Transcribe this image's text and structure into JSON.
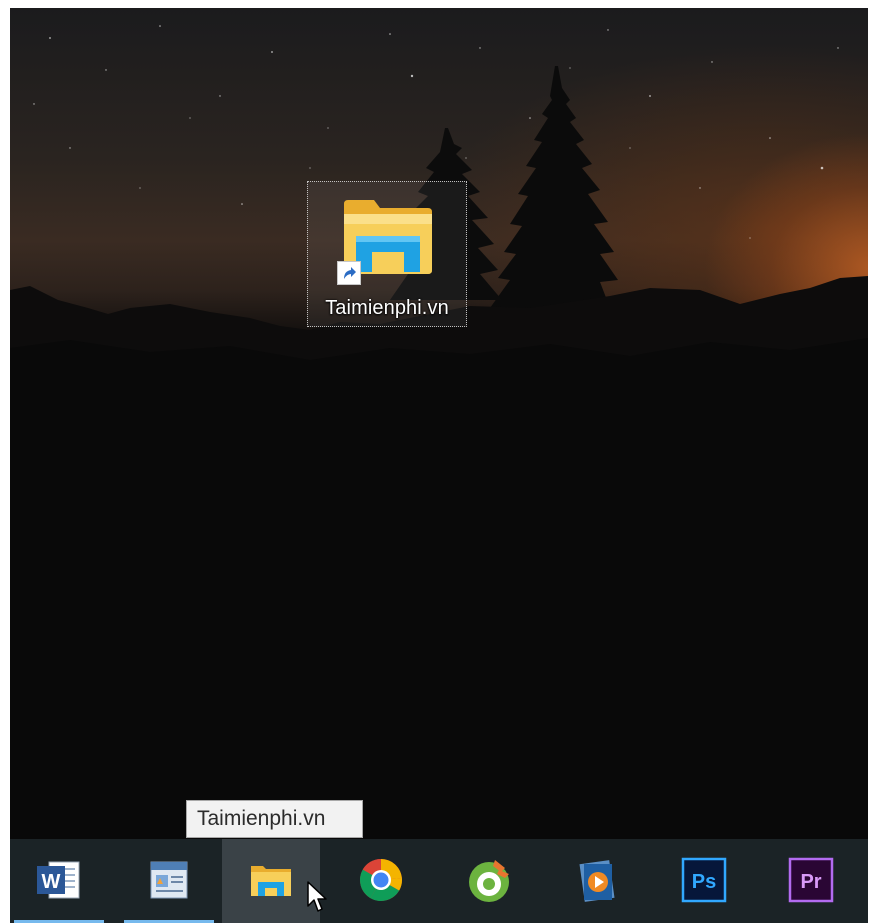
{
  "desktop": {
    "shortcut": {
      "label": "Taimienphi.vn",
      "icon": "file-explorer-folder-icon",
      "overlay_icon": "shortcut-arrow-icon",
      "selected": true
    }
  },
  "tooltip": {
    "text": "Taimienphi.vn"
  },
  "taskbar": {
    "apps": [
      {
        "name": "Microsoft Word",
        "icon": "word-icon",
        "glyph": "W",
        "running": true,
        "active": false
      },
      {
        "name": "Microsoft Publisher",
        "icon": "publisher-icon",
        "running": true,
        "active": false
      },
      {
        "name": "File Explorer",
        "icon": "file-explorer-icon",
        "running": false,
        "active": true
      },
      {
        "name": "Google Chrome",
        "icon": "chrome-icon",
        "running": false,
        "active": false
      },
      {
        "name": "Coc Coc",
        "icon": "coccoc-icon",
        "running": false,
        "active": false
      },
      {
        "name": "Media Player",
        "icon": "media-player-icon",
        "running": false,
        "active": false
      },
      {
        "name": "Adobe Photoshop",
        "icon": "photoshop-icon",
        "glyph": "Ps",
        "running": false,
        "active": false
      },
      {
        "name": "Adobe Premiere",
        "icon": "premiere-icon",
        "glyph": "Pr",
        "running": false,
        "active": false
      }
    ]
  },
  "colors": {
    "taskbar_bg": "#1b2326",
    "taskbar_active": "#3a4247",
    "running_indicator": "#76b9ed",
    "folder_yellow": "#f7c84a",
    "explorer_blue": "#1fa2e3"
  }
}
